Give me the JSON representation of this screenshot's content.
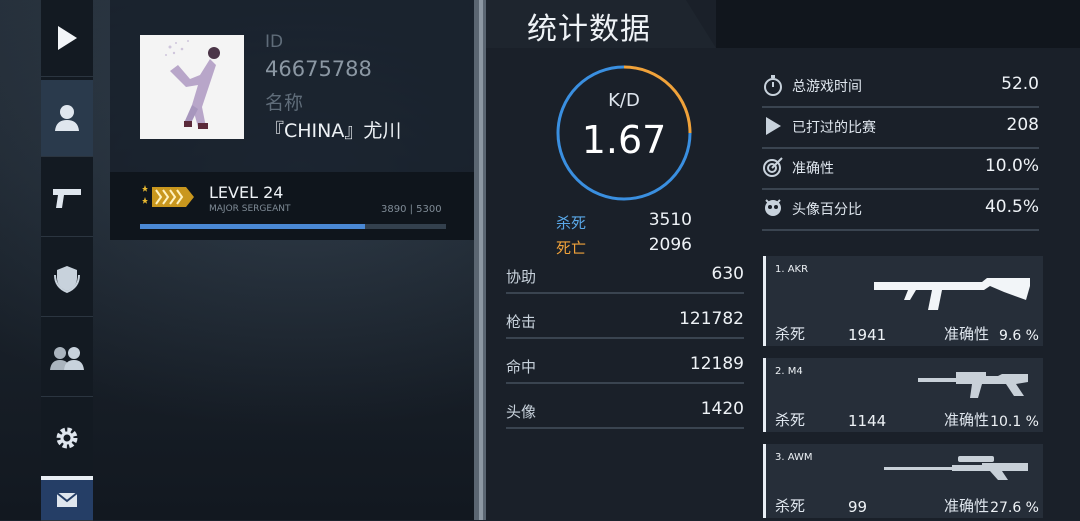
{
  "profile": {
    "id_label": "ID",
    "id_value": "46675788",
    "name_label": "名称",
    "name_value": "『CHINA』尤川"
  },
  "level": {
    "title": "LEVEL 24",
    "rank": "MAJOR SERGEANT",
    "xp_text": "3890 | 5300",
    "progress": 0.734
  },
  "stats": {
    "title": "统计数据",
    "kd_label": "K/D",
    "kd_value": "1.67",
    "kills_label": "杀死",
    "kills_value": "3510",
    "deaths_label": "死亡",
    "deaths_value": "2096",
    "rows": [
      {
        "label": "协助",
        "value": "630"
      },
      {
        "label": "枪击",
        "value": "121782"
      },
      {
        "label": "命中",
        "value": "12189"
      },
      {
        "label": "头像",
        "value": "1420"
      }
    ],
    "info": [
      {
        "icon": "stopwatch-icon",
        "label": "总游戏时间",
        "value": "52.0"
      },
      {
        "icon": "play-icon",
        "label": "已打过的比赛",
        "value": "208"
      },
      {
        "icon": "target-icon",
        "label": "准确性",
        "value": "10.0%"
      },
      {
        "icon": "headshot-icon",
        "label": "头像百分比",
        "value": "40.5%"
      }
    ]
  },
  "weapons": [
    {
      "name": "1. AKR",
      "kills_label": "杀死",
      "kills": "1941",
      "acc_label": "准确性",
      "acc": "9.6 %"
    },
    {
      "name": "2. M4",
      "kills_label": "杀死",
      "kills": "1144",
      "acc_label": "准确性",
      "acc": "10.1 %"
    },
    {
      "name": "3. AWM",
      "kills_label": "杀死",
      "kills": "99",
      "acc_label": "准确性",
      "acc": "27.6 %"
    }
  ],
  "colors": {
    "accent_blue": "#4a88d4",
    "kd_ring_blue": "#3a8fe0",
    "kd_ring_orange": "#f0a23a",
    "kills_color": "#5aa8e8",
    "deaths_color": "#f0a23a",
    "rank_gold": "#e8b830"
  }
}
